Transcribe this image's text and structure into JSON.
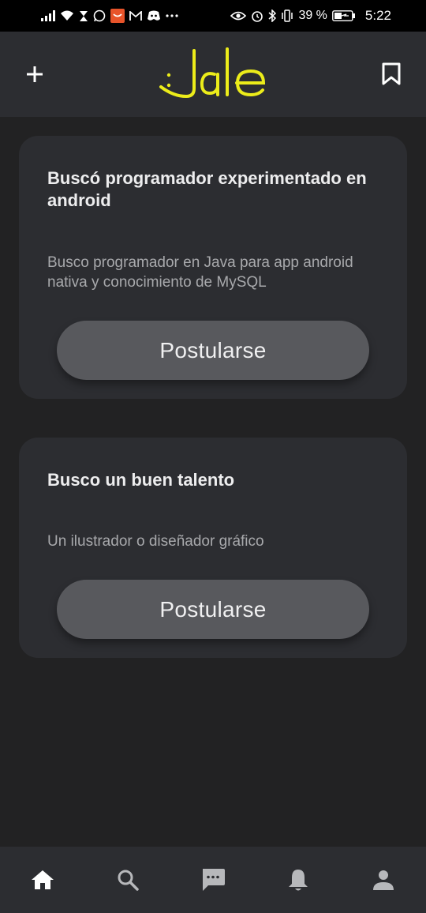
{
  "status_bar": {
    "battery_percent": "39 %",
    "time": "5:22",
    "left_icons": [
      "signal-icon",
      "wifi-icon",
      "hourglass-icon",
      "whatsapp-icon",
      "app-icon",
      "gmail-icon",
      "discord-icon",
      "more-icon"
    ],
    "right_icons": [
      "eye-icon",
      "alarm-icon",
      "bluetooth-icon",
      "vibrate-icon",
      "battery-icon"
    ]
  },
  "header": {
    "brand_color": "#ecec1a",
    "add_icon": "plus-icon",
    "bookmark_icon": "bookmark-icon"
  },
  "posts": [
    {
      "title": "Buscó programador experimentado en android",
      "description": "Busco programador en Java para app android nativa y conocimiento de MySQL",
      "button_label": "Postularse"
    },
    {
      "title": "Busco un buen talento",
      "description": "Un ilustrador o diseñador gráfico",
      "button_label": "Postularse"
    }
  ],
  "bottom_nav": {
    "items": [
      "home-icon",
      "search-icon",
      "chat-icon",
      "notifications-icon",
      "profile-icon"
    ],
    "active": "home-icon"
  }
}
